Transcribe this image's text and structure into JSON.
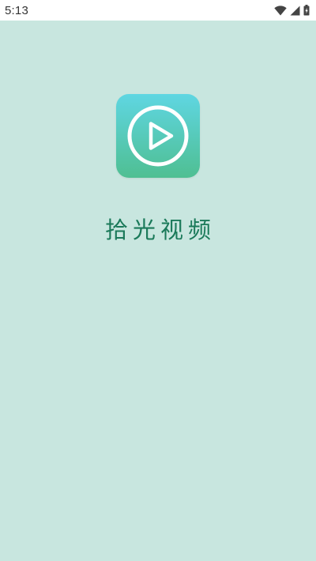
{
  "status_bar": {
    "time": "5:13",
    "icons": [
      "wifi-icon",
      "signal-icon",
      "battery-icon"
    ]
  },
  "splash": {
    "app_icon": "play-icon",
    "app_name": "拾光视频"
  },
  "colors": {
    "background": "#c8e6df",
    "app_name": "#1b7a5a",
    "icon_gradient_top": "#5fd6e2",
    "icon_gradient_bottom": "#4fbf92"
  }
}
